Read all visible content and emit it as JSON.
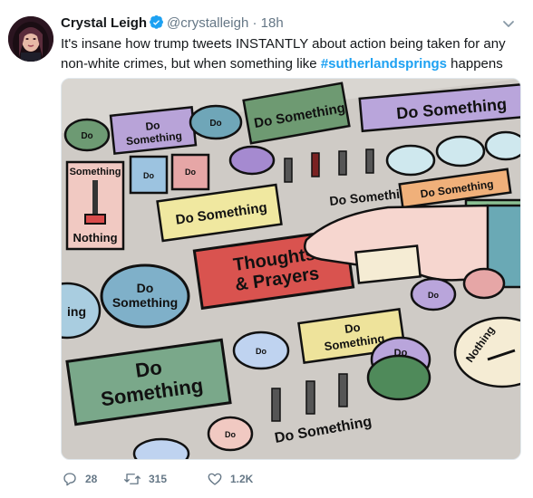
{
  "tweet": {
    "author_name": "Crystal Leigh",
    "handle": "@crystalleigh",
    "separator": "·",
    "time": "18h",
    "text_before": "It's insane how trump tweets INSTANTLY about action being taken for any non-white crimes, but when something like ",
    "hashtag": "#sutherlandsprings",
    "text_after": " happens"
  },
  "image": {
    "do_something": "Do Something",
    "do": "Do",
    "something": "Something",
    "do_some_thing": "Do Some thing",
    "thoughts_prayers_line1": "Thoughts",
    "thoughts_prayers_line2": "& Prayers",
    "nothing": "Nothing",
    "slider_label": "Something",
    "partial_ng": "ing",
    "partial_nothing": "Nothing"
  },
  "actions": {
    "replies": "28",
    "retweets": "315",
    "likes": "1.2K"
  },
  "colors": {
    "link_blue": "#1da1f2",
    "verified_blue": "#1da1f2",
    "secondary_gray": "#657786"
  }
}
